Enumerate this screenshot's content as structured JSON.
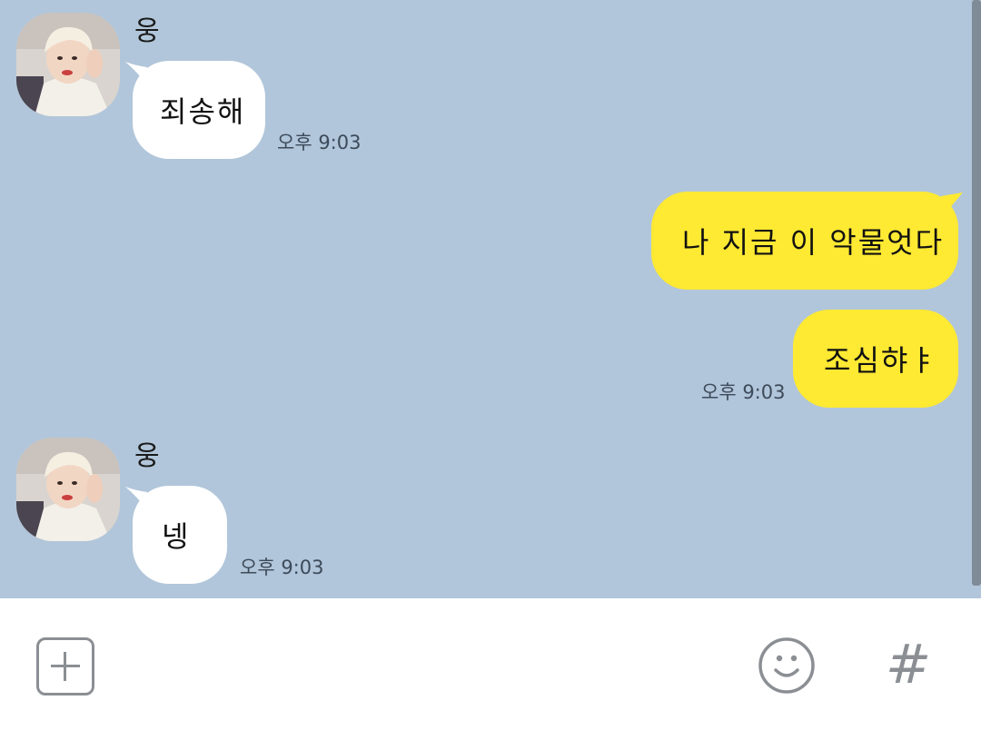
{
  "theme": {
    "chat_background": "#b1c6da",
    "outgoing_bubble": "#fee933",
    "incoming_bubble": "#ffffff",
    "scrollbar": "#7f8c98"
  },
  "messages": [
    {
      "direction": "incoming",
      "sender": "웅",
      "text": "죄송해",
      "time": "오후 9:03"
    },
    {
      "direction": "outgoing",
      "text": "나 지금 이 악물엇다"
    },
    {
      "direction": "outgoing",
      "text": "조심햐ㅑ",
      "time": "오후 9:03"
    },
    {
      "direction": "incoming",
      "sender": "웅",
      "text": "넹",
      "time": "오후 9:03"
    }
  ],
  "input_bar": {
    "plus_icon": "plus-square-icon",
    "emoji_icon": "smiley-face-icon",
    "hash_icon": "hash-icon",
    "hash_glyph": "#"
  }
}
